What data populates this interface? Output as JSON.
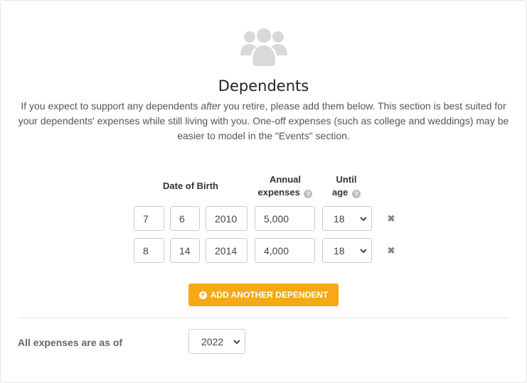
{
  "section": {
    "icon": "people-group-icon",
    "title": "Dependents",
    "intro_before": "If you expect to support any dependents ",
    "intro_emphasis": "after",
    "intro_after": " you retire, please add them below. This section is best suited for your dependents' expenses while still living with you. One-off expenses (such as college and weddings) may be easier to model in the \"Events\" section."
  },
  "columns": {
    "dob": "Date of Birth",
    "expenses_line1": "Annual",
    "expenses_line2": "expenses",
    "until_line1": "Until",
    "until_line2": "age",
    "help_glyph": "?"
  },
  "dependents": [
    {
      "month": "7",
      "day": "6",
      "year": "2010",
      "expenses": "5,000",
      "until_age": "18"
    },
    {
      "month": "8",
      "day": "14",
      "year": "2014",
      "expenses": "4,000",
      "until_age": "18"
    }
  ],
  "remove_glyph": "✖",
  "add_button": {
    "label": "ADD ANOTHER DEPENDENT",
    "icon": "plus-circle-icon",
    "color": "#f6a912"
  },
  "as_of": {
    "label": "All expenses are as of",
    "year": "2022"
  }
}
